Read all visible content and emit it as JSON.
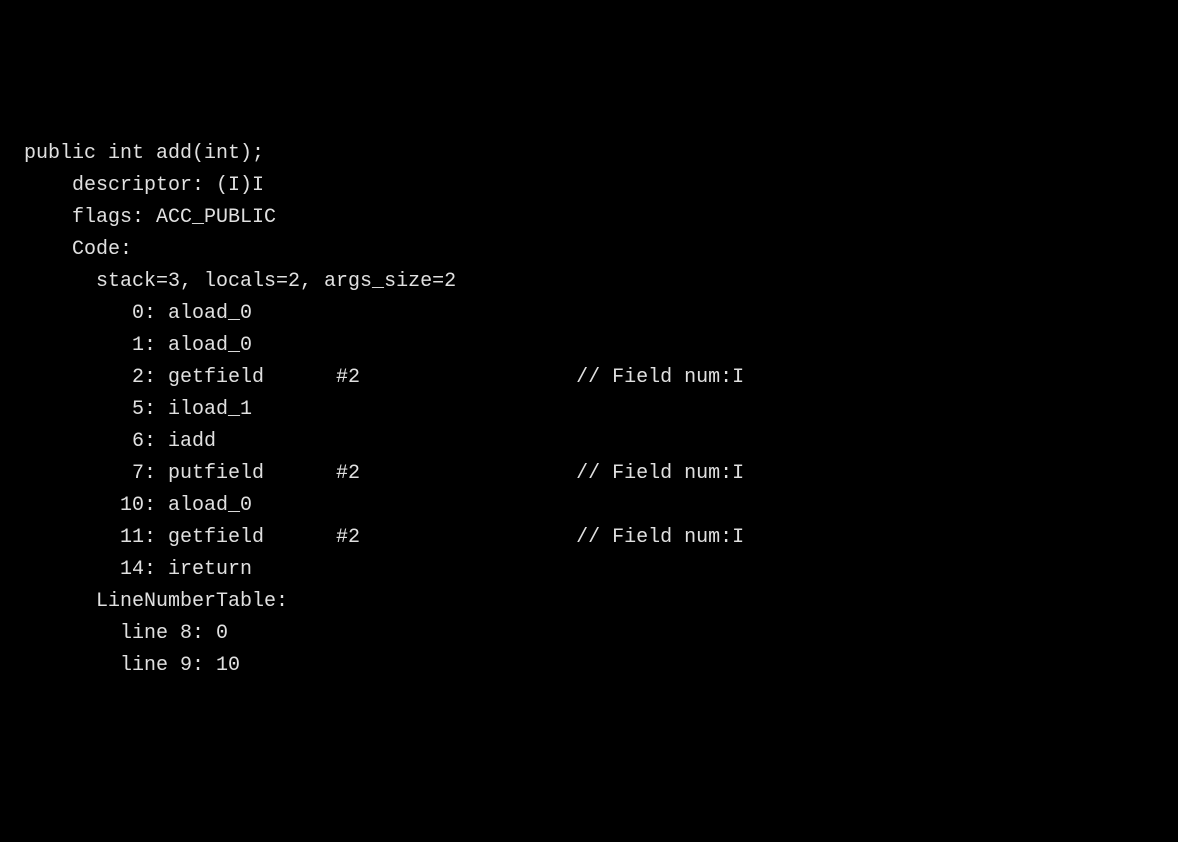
{
  "method_signature": "public int add(int);",
  "descriptor": "    descriptor: (I)I",
  "flags": "    flags: ACC_PUBLIC",
  "code_header": "    Code:",
  "stack_info": "      stack=3, locals=2, args_size=2",
  "instructions": [
    "         0: aload_0",
    "         1: aload_0",
    "         2: getfield      #2                  // Field num:I",
    "         5: iload_1",
    "         6: iadd",
    "         7: putfield      #2                  // Field num:I",
    "        10: aload_0",
    "        11: getfield      #2                  // Field num:I",
    "        14: ireturn"
  ],
  "line_number_table_header": "      LineNumberTable:",
  "line_number_table": [
    "        line 8: 0",
    "        line 9: 10"
  ]
}
